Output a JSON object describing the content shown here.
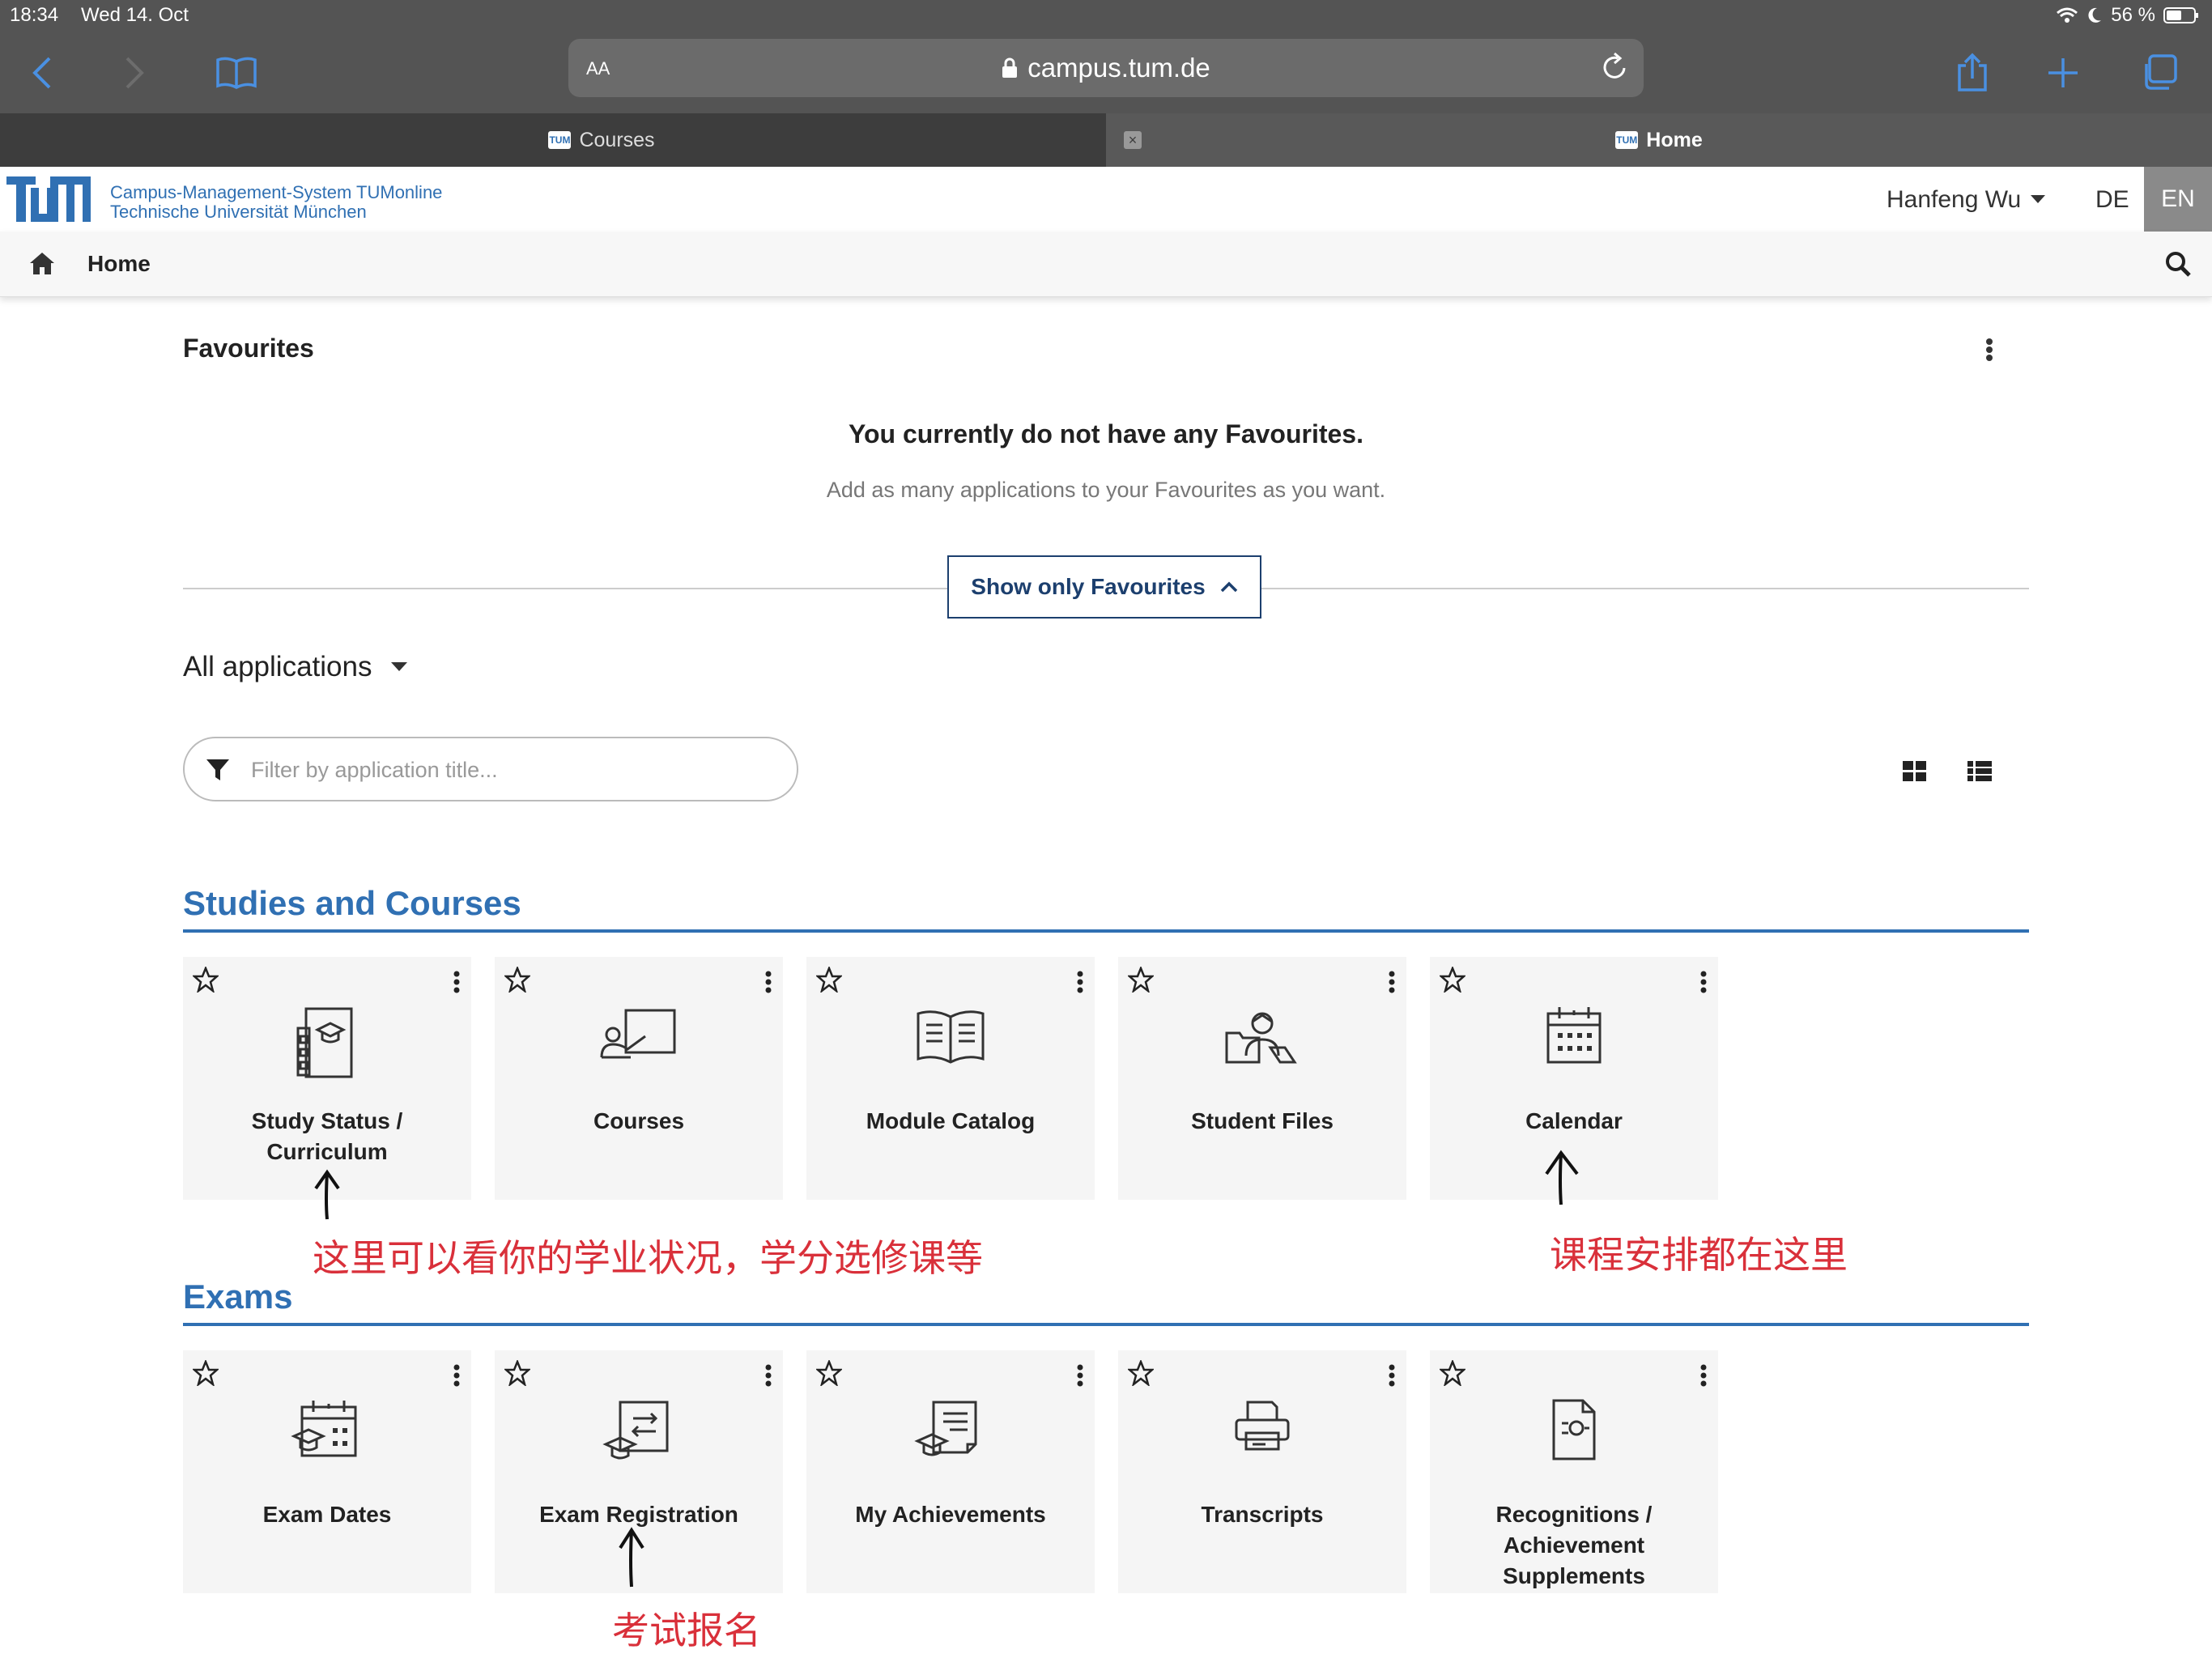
{
  "status_bar": {
    "time": "18:34",
    "date": "Wed 14. Oct",
    "battery": "56 %"
  },
  "browser": {
    "aa_label": "AA",
    "url": "campus.tum.de",
    "tabs": [
      {
        "label": "Courses",
        "active": false
      },
      {
        "label": "Home",
        "active": true
      }
    ]
  },
  "header": {
    "logo_text": "TUM",
    "system_line1": "Campus-Management-System TUMonline",
    "system_line2": "Technische Universität München",
    "user": "Hanfeng Wu",
    "lang_de": "DE",
    "lang_en": "EN"
  },
  "nav": {
    "home": "Home"
  },
  "favourites": {
    "title": "Favourites",
    "empty_title": "You currently do not have any Favourites.",
    "empty_hint": "Add as many applications to your Favourites as you want.",
    "toggle_button": "Show only Favourites"
  },
  "applications": {
    "dropdown_label": "All applications",
    "filter_placeholder": "Filter by application title..."
  },
  "sections": [
    {
      "title": "Studies and Courses",
      "tiles": [
        {
          "label": "Study Status / Curriculum",
          "icon": "study-status-icon"
        },
        {
          "label": "Courses",
          "icon": "courses-icon"
        },
        {
          "label": "Module Catalog",
          "icon": "module-catalog-icon"
        },
        {
          "label": "Student Files",
          "icon": "student-files-icon"
        },
        {
          "label": "Calendar",
          "icon": "calendar-icon"
        }
      ]
    },
    {
      "title": "Exams",
      "tiles": [
        {
          "label": "Exam Dates",
          "icon": "exam-dates-icon"
        },
        {
          "label": "Exam Registration",
          "icon": "exam-registration-icon"
        },
        {
          "label": "My Achievements",
          "icon": "achievements-icon"
        },
        {
          "label": "Transcripts",
          "icon": "transcripts-icon"
        },
        {
          "label": "Recognitions / Achievement Supplements",
          "icon": "recognitions-icon"
        }
      ]
    }
  ],
  "annotations": {
    "study_status": "这里可以看你的学业状况，学分选修课等",
    "calendar": "课程安排都在这里",
    "exam_registration": "考试报名"
  },
  "colors": {
    "brand_blue": "#3070b3",
    "annotation_red": "#d9303a",
    "chrome_gray": "#545454"
  }
}
